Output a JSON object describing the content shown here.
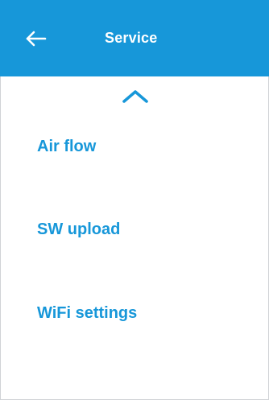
{
  "header": {
    "title": "Service",
    "back_icon": "arrow-left-icon",
    "background_color": "#1797d9",
    "text_color": "#ffffff"
  },
  "scroll_up_icon": "chevron-up-icon",
  "menu": {
    "accent_color": "#1797d9",
    "items": [
      {
        "label": "Air flow"
      },
      {
        "label": "SW upload"
      },
      {
        "label": "WiFi settings"
      }
    ]
  }
}
